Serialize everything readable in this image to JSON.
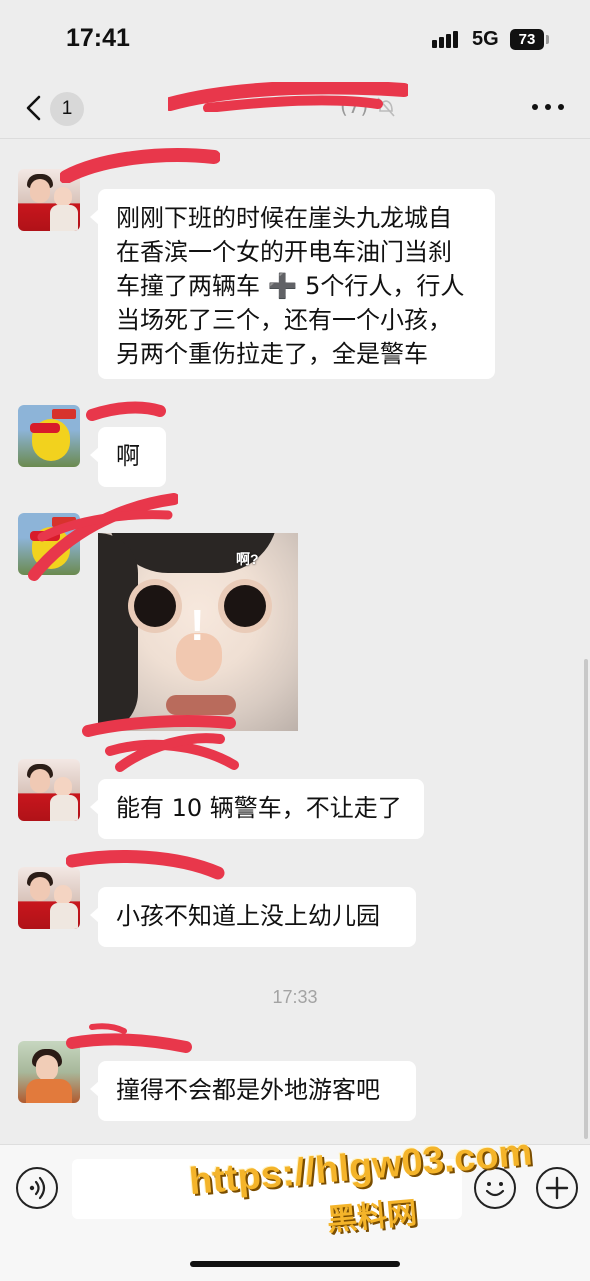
{
  "status_bar": {
    "time": "17:41",
    "network": "5G",
    "battery": "73"
  },
  "nav": {
    "unread_count": "1",
    "title": "(7)"
  },
  "messages": [
    {
      "type": "text",
      "nickname": "",
      "lines": [
        "刚刚下班的时候在崖头九龙城自",
        "在香滨一个女的开电车油门当刹",
        "车撞了两辆车 ➕ 5个行人，行人",
        "当场死了三个，还有一个小孩，",
        "另两个重伤拉走了，全是警车"
      ]
    },
    {
      "type": "text",
      "nickname": "",
      "lines": [
        "啊"
      ]
    },
    {
      "type": "sticker",
      "nickname": "",
      "caption": "啊?",
      "mark": "!"
    },
    {
      "type": "text",
      "nickname": "",
      "lines": [
        "能有 10 辆警车，不让走了"
      ]
    },
    {
      "type": "text",
      "nickname": "",
      "lines": [
        "小孩不知道上没上幼儿园"
      ]
    },
    {
      "type": "text",
      "nickname": "",
      "lines": [
        "撞得不会都是外地游客吧"
      ]
    }
  ],
  "time_separator": "17:33",
  "input": {
    "value": ""
  },
  "watermark": {
    "url": "https://hlgw03.com",
    "site": "黑料网"
  },
  "colors": {
    "background": "#ededed",
    "bubble": "#ffffff",
    "redaction": "#e8374b",
    "watermark": "#f4b42a"
  },
  "icons": [
    "back-chevron-icon",
    "more-dots-icon",
    "voice-icon",
    "emoji-icon",
    "plus-icon",
    "mute-bell-icon"
  ]
}
